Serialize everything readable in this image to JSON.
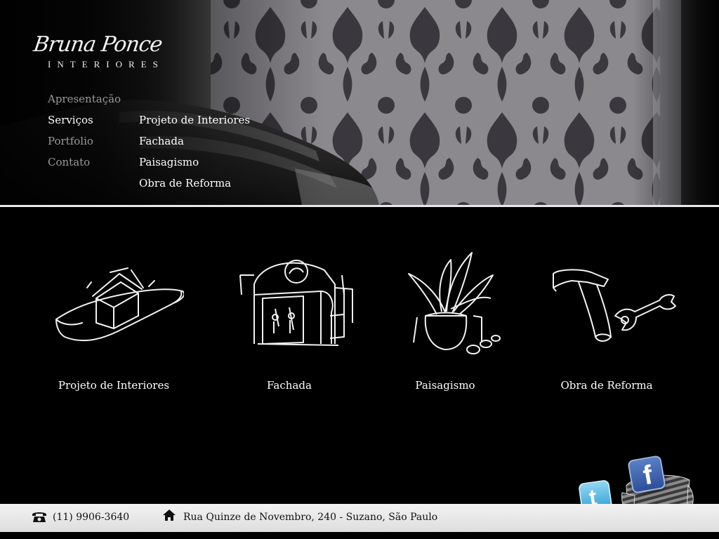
{
  "logo": {
    "script": "Bruna Ponce",
    "sub": "INTERIORES"
  },
  "nav": {
    "items": [
      {
        "label": "Apresentação",
        "active": false
      },
      {
        "label": "Serviços",
        "active": true
      },
      {
        "label": "Portfolio",
        "active": false
      },
      {
        "label": "Contato",
        "active": false
      }
    ],
    "submenu": [
      "Projeto de Interiores",
      "Fachada",
      "Paisagismo",
      "Obra de Reforma"
    ]
  },
  "services": [
    {
      "label": "Projeto de Interiores",
      "icon": "house-blueprint-icon"
    },
    {
      "label": "Fachada",
      "icon": "storefront-icon"
    },
    {
      "label": "Paisagismo",
      "icon": "potted-plant-icon"
    },
    {
      "label": "Obra de Reforma",
      "icon": "hammer-wrench-icon"
    }
  ],
  "social": {
    "facebook": "f",
    "twitter": "t"
  },
  "footer": {
    "phone": "(11) 9906-3640",
    "address": "Rua Quinze de Novembro, 240 - Suzano, São Paulo"
  },
  "colors": {
    "background": "#000000",
    "footer": "#e6e6e6",
    "nav_inactive": "#9a9a9a"
  }
}
